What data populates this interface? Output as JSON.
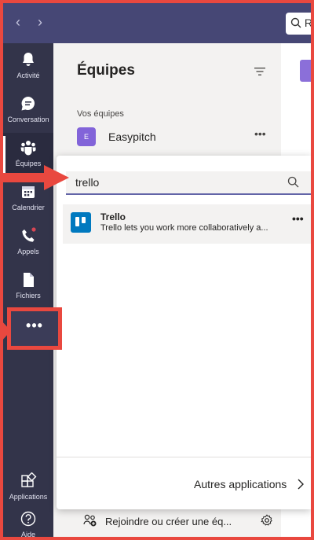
{
  "titlebar": {
    "search_placeholder": "R"
  },
  "rail": {
    "items": [
      {
        "label": "Activité",
        "icon": "bell-icon"
      },
      {
        "label": "Conversation",
        "icon": "chat-icon"
      },
      {
        "label": "Équipes",
        "icon": "teams-icon"
      },
      {
        "label": "Calendrier",
        "icon": "calendar-icon"
      },
      {
        "label": "Appels",
        "icon": "phone-icon"
      },
      {
        "label": "Fichiers",
        "icon": "file-icon"
      }
    ],
    "more_label": "•••",
    "applications_label": "Applications",
    "help_label": "Aide"
  },
  "teams_panel": {
    "title": "Équipes",
    "section_label": "Vos équipes",
    "team": {
      "avatar_letter": "E",
      "name": "Easypitch",
      "more": "•••"
    },
    "join_label": "Rejoindre ou créer une éq..."
  },
  "popup": {
    "search_value": "trello",
    "result": {
      "name": "Trello",
      "description": "Trello lets you work more collaboratively a...",
      "more": "•••"
    },
    "other_apps_label": "Autres applications"
  },
  "colors": {
    "accent": "#6264a7",
    "titlebar": "#464775",
    "rail": "#33344a",
    "annotation": "#e9483f",
    "trello": "#0079bf"
  }
}
